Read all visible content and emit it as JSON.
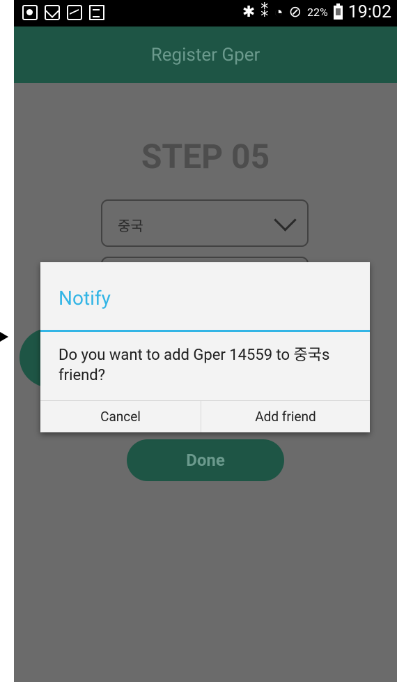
{
  "status_bar": {
    "battery_percent": "22%",
    "time": "19:02",
    "left_icons": [
      "notification-circle-icon",
      "mail-icon",
      "image-icon",
      "doc-icon"
    ],
    "right_icons": [
      "bluetooth-icon",
      "vibrate-icon",
      "wifi-icon",
      "blocked-icon",
      "battery-icon"
    ]
  },
  "header": {
    "title": "Register Gper"
  },
  "screen": {
    "step_title": "STEP 05",
    "country_select_value": "중국",
    "done_label": "Done"
  },
  "dialog": {
    "title": "Notify",
    "message": "Do you want to add Gper 14559 to 중국s friend?",
    "cancel_label": "Cancel",
    "add_label": "Add friend",
    "accent_color": "#33b5e5"
  },
  "colors": {
    "header_bg": "#1e5545",
    "overlay_bg": "#6b6b6b"
  }
}
